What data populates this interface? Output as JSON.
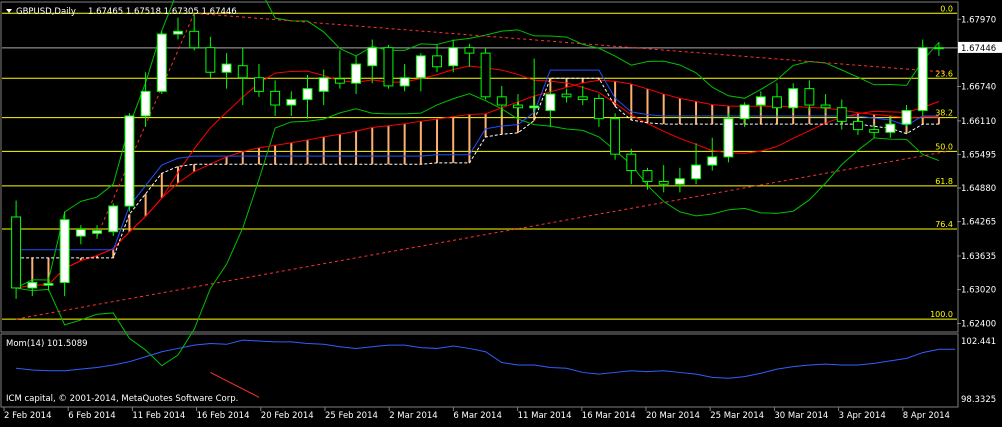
{
  "header": {
    "symbol_label": "GBPUSD,Daily",
    "ohlc_text": "1.67465 1.67518 1.67305 1.67446"
  },
  "momentum": {
    "label": "Mom(14) 101.5089",
    "axis_labels": [
      "102.441",
      "98.3325"
    ]
  },
  "copyright": "ICM capital, © 2001-2014, MetaQuotes Software Corp.",
  "price_axis": [
    "1.67970",
    "1.67446",
    "1.66740",
    "1.66110",
    "1.65495",
    "1.64880",
    "1.64265",
    "1.63635",
    "1.63020",
    "1.62400"
  ],
  "fib_levels": [
    "0.0",
    "23.6",
    "38.2",
    "50.0",
    "61.8",
    "76.4",
    "100.0"
  ],
  "date_axis": [
    "2 Feb 2014",
    "6 Feb 2014",
    "11 Feb 2014",
    "16 Feb 2014",
    "20 Feb 2014",
    "25 Feb 2014",
    "2 Mar 2014",
    "6 Mar 2014",
    "11 Mar 2014",
    "16 Mar 2014",
    "20 Mar 2014",
    "25 Mar 2014",
    "30 Mar 2014",
    "3 Apr 2014",
    "8 Apr 2014"
  ],
  "colors": {
    "background": "#000000",
    "grid": "#ffffff",
    "fib": "#ffff00",
    "bollinger": "#00c000",
    "ma_red": "#ff0000",
    "ma_blue": "#1e50ff",
    "cloud": "#ffb070",
    "momentum": "#3060ff",
    "candle_up": "#ffffff",
    "candle_down": "#000000",
    "wick": "#00ff00",
    "trendline": "#ff3030"
  },
  "chart_data": {
    "type": "candlestick",
    "symbol": "GBPUSD",
    "timeframe": "Daily",
    "ylim": [
      1.6228,
      1.6825
    ],
    "fibonacci": [
      {
        "level": "0.0",
        "price": 1.6808
      },
      {
        "level": "23.6",
        "price": 1.6689
      },
      {
        "level": "38.2",
        "price": 1.6617
      },
      {
        "level": "50.0",
        "price": 1.6555
      },
      {
        "level": "61.8",
        "price": 1.6492
      },
      {
        "level": "76.4",
        "price": 1.6413
      },
      {
        "level": "100.0",
        "price": 1.6248
      }
    ],
    "current_price": 1.67446,
    "candles": [
      {
        "o": 1.6435,
        "h": 1.6465,
        "l": 1.6285,
        "c": 1.6305
      },
      {
        "o": 1.6305,
        "h": 1.632,
        "l": 1.629,
        "c": 1.6315
      },
      {
        "o": 1.631,
        "h": 1.6322,
        "l": 1.63,
        "c": 1.6313
      },
      {
        "o": 1.6315,
        "h": 1.6445,
        "l": 1.629,
        "c": 1.643
      },
      {
        "o": 1.64,
        "h": 1.642,
        "l": 1.6385,
        "c": 1.6412
      },
      {
        "o": 1.6405,
        "h": 1.642,
        "l": 1.6395,
        "c": 1.641
      },
      {
        "o": 1.6408,
        "h": 1.646,
        "l": 1.64,
        "c": 1.6455
      },
      {
        "o": 1.6455,
        "h": 1.6625,
        "l": 1.6445,
        "c": 1.662
      },
      {
        "o": 1.662,
        "h": 1.67,
        "l": 1.66,
        "c": 1.6665
      },
      {
        "o": 1.6665,
        "h": 1.6775,
        "l": 1.666,
        "c": 1.677
      },
      {
        "o": 1.677,
        "h": 1.68,
        "l": 1.676,
        "c": 1.6775
      },
      {
        "o": 1.6775,
        "h": 1.6808,
        "l": 1.674,
        "c": 1.6745
      },
      {
        "o": 1.6745,
        "h": 1.6765,
        "l": 1.669,
        "c": 1.67
      },
      {
        "o": 1.67,
        "h": 1.6735,
        "l": 1.667,
        "c": 1.6715
      },
      {
        "o": 1.6712,
        "h": 1.6745,
        "l": 1.664,
        "c": 1.669
      },
      {
        "o": 1.669,
        "h": 1.6715,
        "l": 1.6655,
        "c": 1.6665
      },
      {
        "o": 1.6665,
        "h": 1.6685,
        "l": 1.662,
        "c": 1.664
      },
      {
        "o": 1.664,
        "h": 1.6665,
        "l": 1.662,
        "c": 1.665
      },
      {
        "o": 1.665,
        "h": 1.6695,
        "l": 1.6615,
        "c": 1.667
      },
      {
        "o": 1.6665,
        "h": 1.6705,
        "l": 1.664,
        "c": 1.669
      },
      {
        "o": 1.6688,
        "h": 1.674,
        "l": 1.667,
        "c": 1.668
      },
      {
        "o": 1.668,
        "h": 1.673,
        "l": 1.666,
        "c": 1.6715
      },
      {
        "o": 1.6712,
        "h": 1.676,
        "l": 1.668,
        "c": 1.6745
      },
      {
        "o": 1.6745,
        "h": 1.675,
        "l": 1.667,
        "c": 1.6675
      },
      {
        "o": 1.6675,
        "h": 1.6715,
        "l": 1.6665,
        "c": 1.669
      },
      {
        "o": 1.669,
        "h": 1.6735,
        "l": 1.6665,
        "c": 1.673
      },
      {
        "o": 1.673,
        "h": 1.675,
        "l": 1.67,
        "c": 1.671
      },
      {
        "o": 1.6712,
        "h": 1.676,
        "l": 1.67,
        "c": 1.6745
      },
      {
        "o": 1.6745,
        "h": 1.6752,
        "l": 1.671,
        "c": 1.6735
      },
      {
        "o": 1.6735,
        "h": 1.6745,
        "l": 1.665,
        "c": 1.6655
      },
      {
        "o": 1.6655,
        "h": 1.6675,
        "l": 1.662,
        "c": 1.664
      },
      {
        "o": 1.664,
        "h": 1.666,
        "l": 1.6615,
        "c": 1.6635
      },
      {
        "o": 1.6635,
        "h": 1.6725,
        "l": 1.6625,
        "c": 1.6638
      },
      {
        "o": 1.663,
        "h": 1.6665,
        "l": 1.66,
        "c": 1.666
      },
      {
        "o": 1.666,
        "h": 1.667,
        "l": 1.6645,
        "c": 1.6655
      },
      {
        "o": 1.6655,
        "h": 1.6675,
        "l": 1.664,
        "c": 1.665
      },
      {
        "o": 1.6652,
        "h": 1.666,
        "l": 1.66,
        "c": 1.6615
      },
      {
        "o": 1.6615,
        "h": 1.6625,
        "l": 1.654,
        "c": 1.655
      },
      {
        "o": 1.655,
        "h": 1.656,
        "l": 1.6495,
        "c": 1.652
      },
      {
        "o": 1.652,
        "h": 1.6525,
        "l": 1.6485,
        "c": 1.65
      },
      {
        "o": 1.65,
        "h": 1.653,
        "l": 1.648,
        "c": 1.6495
      },
      {
        "o": 1.6495,
        "h": 1.6525,
        "l": 1.648,
        "c": 1.6505
      },
      {
        "o": 1.6505,
        "h": 1.657,
        "l": 1.6495,
        "c": 1.653
      },
      {
        "o": 1.653,
        "h": 1.658,
        "l": 1.652,
        "c": 1.6545
      },
      {
        "o": 1.6545,
        "h": 1.6625,
        "l": 1.6535,
        "c": 1.6615
      },
      {
        "o": 1.6615,
        "h": 1.6645,
        "l": 1.66,
        "c": 1.664
      },
      {
        "o": 1.664,
        "h": 1.6665,
        "l": 1.6625,
        "c": 1.6655
      },
      {
        "o": 1.6655,
        "h": 1.668,
        "l": 1.662,
        "c": 1.6635
      },
      {
        "o": 1.6635,
        "h": 1.668,
        "l": 1.6625,
        "c": 1.667
      },
      {
        "o": 1.667,
        "h": 1.6685,
        "l": 1.663,
        "c": 1.664
      },
      {
        "o": 1.664,
        "h": 1.666,
        "l": 1.6625,
        "c": 1.6635
      },
      {
        "o": 1.6635,
        "h": 1.665,
        "l": 1.6595,
        "c": 1.661
      },
      {
        "o": 1.661,
        "h": 1.6615,
        "l": 1.6585,
        "c": 1.6595
      },
      {
        "o": 1.6595,
        "h": 1.6605,
        "l": 1.658,
        "c": 1.659
      },
      {
        "o": 1.659,
        "h": 1.662,
        "l": 1.658,
        "c": 1.6605
      },
      {
        "o": 1.6605,
        "h": 1.664,
        "l": 1.66,
        "c": 1.663
      },
      {
        "o": 1.663,
        "h": 1.676,
        "l": 1.662,
        "c": 1.6745
      },
      {
        "o": 1.6745,
        "h": 1.6755,
        "l": 1.673,
        "c": 1.67446
      }
    ],
    "momentum_series": [
      100.55,
      100.45,
      100.4,
      100.4,
      100.5,
      100.6,
      100.75,
      100.95,
      101.25,
      101.55,
      101.75,
      101.95,
      102.05,
      102.0,
      102.25,
      102.2,
      102.15,
      102.15,
      102.05,
      102.0,
      101.85,
      101.75,
      101.85,
      101.95,
      101.95,
      101.8,
      101.75,
      101.9,
      101.75,
      101.55,
      100.9,
      100.75,
      100.75,
      100.6,
      100.55,
      100.3,
      100.2,
      100.3,
      100.4,
      100.35,
      100.4,
      100.3,
      100.2,
      100.0,
      99.95,
      100.05,
      100.25,
      100.5,
      100.65,
      100.75,
      100.8,
      100.75,
      100.75,
      100.85,
      101.0,
      101.15,
      101.5,
      101.7,
      101.7
    ],
    "momentum_ylim": [
      98.3325,
      102.441
    ]
  }
}
